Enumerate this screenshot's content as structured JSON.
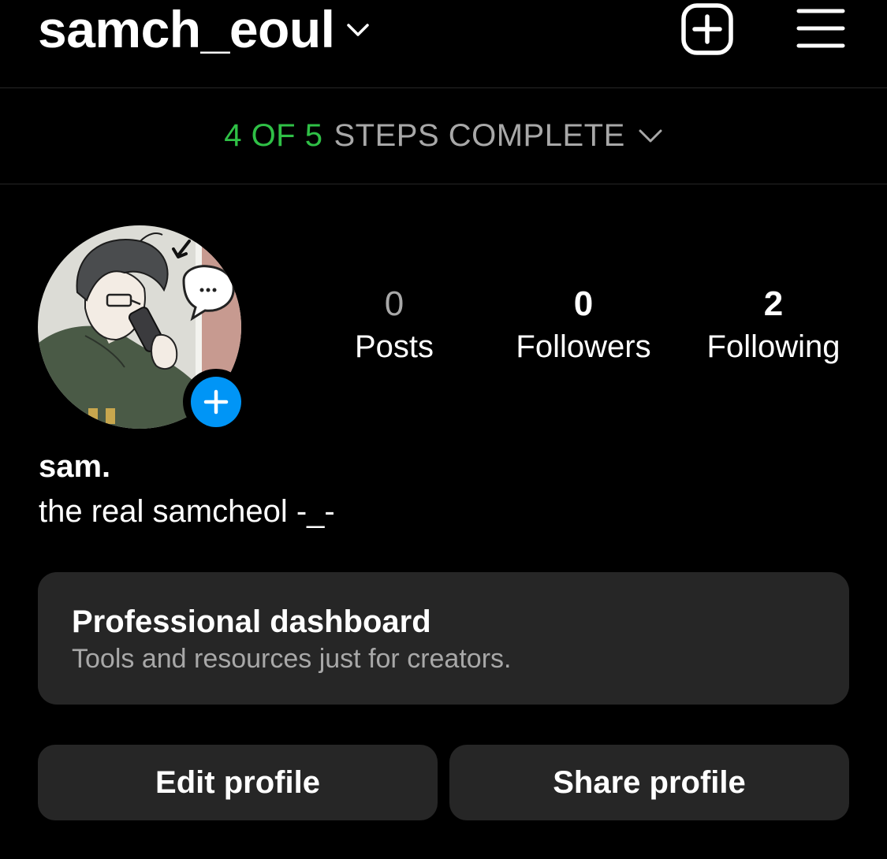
{
  "header": {
    "username": "samch_eoul",
    "username_chevron_icon": "chevron-down-icon",
    "new_post_icon": "plus-square-icon",
    "menu_icon": "hamburger-menu-icon"
  },
  "steps_banner": {
    "progress_text": "4 OF 5",
    "rest_text": "STEPS COMPLETE",
    "steps_done": 4,
    "steps_total": 5,
    "chevron_icon": "chevron-down-icon",
    "progress_color": "#2fc046"
  },
  "profile": {
    "avatar_icon": "profile-avatar-illustration",
    "add_story_icon": "plus-icon",
    "display_name": "sam.",
    "bio": "the real samcheol -_-"
  },
  "stats": {
    "posts": {
      "value": "0",
      "label": "Posts"
    },
    "followers": {
      "value": "0",
      "label": "Followers"
    },
    "following": {
      "value": "2",
      "label": "Following"
    }
  },
  "dashboard": {
    "title": "Professional dashboard",
    "subtitle": "Tools and resources just for creators."
  },
  "actions": {
    "edit_label": "Edit profile",
    "share_label": "Share profile"
  },
  "colors": {
    "background": "#000000",
    "surface": "#262626",
    "accent_blue": "#0095f6",
    "muted_text": "#a8a8a8",
    "success_green": "#2fc046"
  }
}
